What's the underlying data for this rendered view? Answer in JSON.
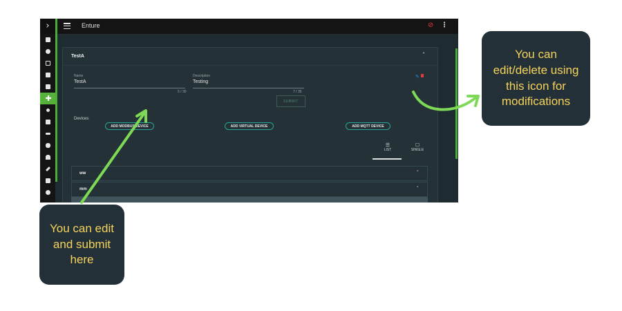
{
  "app": {
    "sidebar_toggle": "›",
    "brand": "Enture"
  },
  "panel": {
    "title": "TestA",
    "name_label": "Name",
    "name_value": "TestA",
    "name_counter": "5 / 30",
    "description_label": "Description",
    "description_value": "Testing",
    "description_counter": "7 / 35",
    "submit_label": "SUBMIT",
    "devices_label": "Devices",
    "buttons": {
      "modbus": "ADD MODBUS DEVICE",
      "virtual": "ADD VIRTUAL DEVICE",
      "mqtt": "ADD MQTT DEVICE"
    },
    "view_list": "LIST",
    "view_single": "SINGLE",
    "devices": [
      "ww",
      "mm"
    ]
  },
  "callouts": {
    "right": "You can edit/delete using this icon for modifications",
    "left": "You can edit and submit here"
  },
  "colors": {
    "accent_green": "#4cae3a",
    "callout_text": "#f5d35b",
    "callout_bg": "#243038",
    "edit_icon": "#2196f3",
    "delete_icon": "#e53935"
  }
}
